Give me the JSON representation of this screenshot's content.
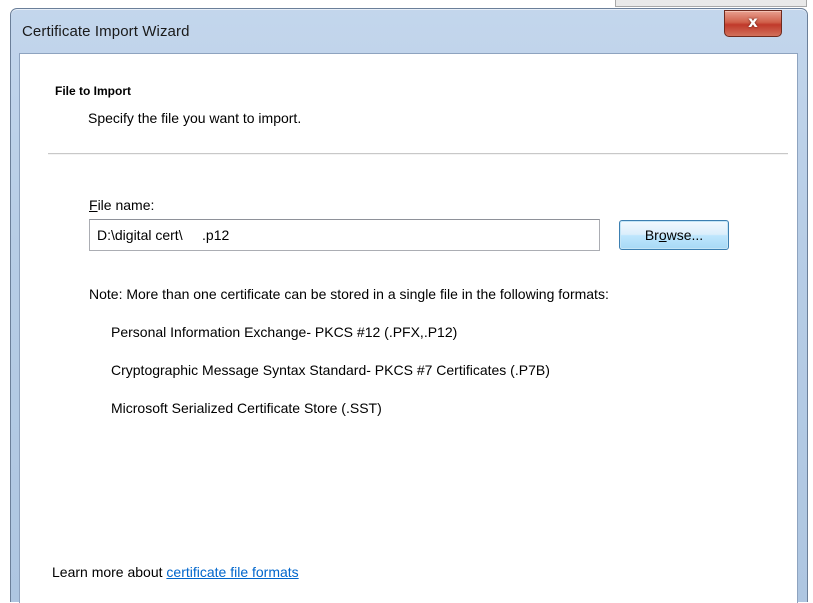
{
  "window": {
    "title": "Certificate Import Wizard",
    "close_glyph": "x"
  },
  "header": {
    "title": "File to Import",
    "subtitle": "Specify the file you want to import."
  },
  "file_field": {
    "label_mnemonic": "F",
    "label_rest": "ile name:",
    "value": "D:\\digital cert\\     .p12"
  },
  "browse_button": {
    "label_pre": "Br",
    "label_mnemonic": "o",
    "label_post": "wse..."
  },
  "note": "Note:  More than one certificate can be stored in a single file in the following formats:",
  "formats": [
    "Personal Information Exchange- PKCS #12 (.PFX,.P12)",
    "Cryptographic Message Syntax Standard- PKCS #7 Certificates (.P7B)",
    "Microsoft Serialized Certificate Store (.SST)"
  ],
  "footer": {
    "learn_more_prefix": "Learn more about ",
    "link_text": "certificate file formats"
  },
  "colors": {
    "link": "#0066cc",
    "close_button": "#c0392b",
    "title_bar": "#b7cde6"
  }
}
